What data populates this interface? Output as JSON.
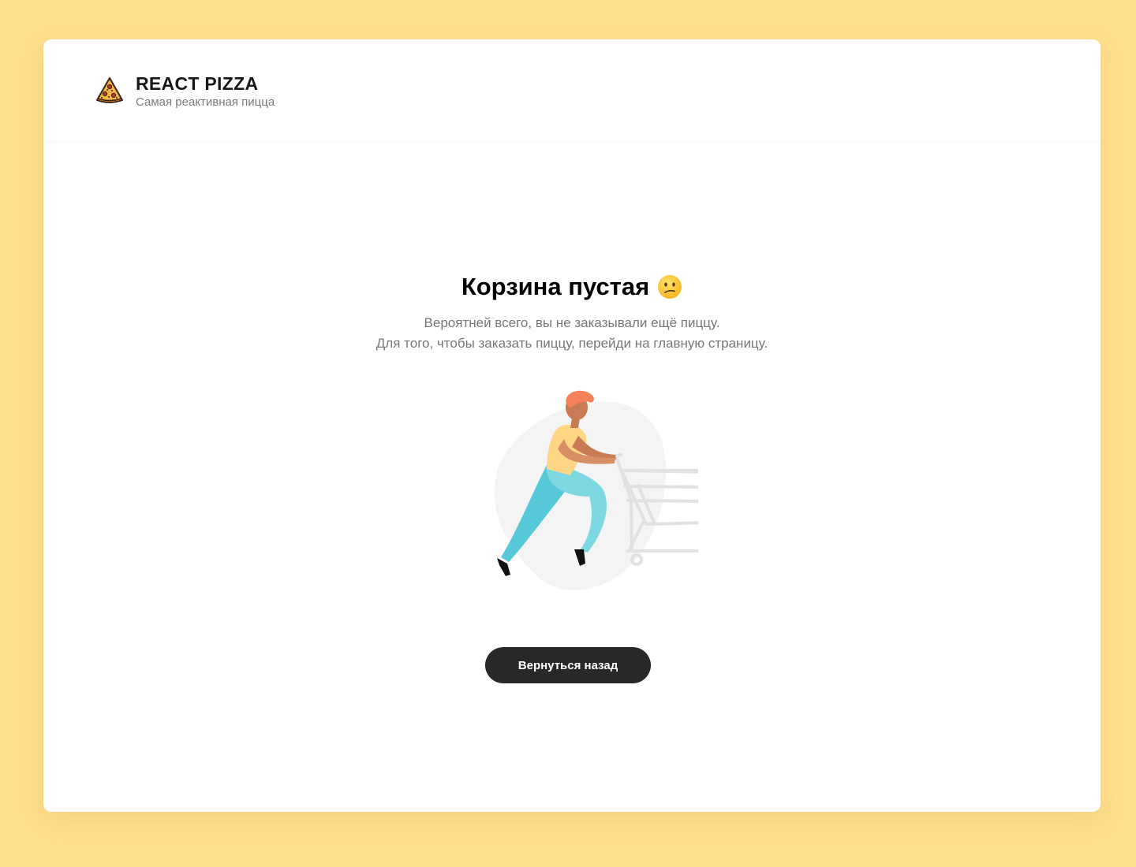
{
  "header": {
    "logo_icon": "pizza-slice-icon",
    "title": "REACT PIZZA",
    "subtitle": "Самая реактивная пицца"
  },
  "cart_empty": {
    "title": "Корзина пустая",
    "title_emoji_icon": "confused-face-emoji",
    "description_line1": "Вероятней всего, вы не заказывали ещё пиццу.",
    "description_line2": "Для того, чтобы заказать пиццу, перейди на главную страницу.",
    "illustration": "person-pushing-shopping-cart",
    "back_button_label": "Вернуться назад"
  },
  "colors": {
    "page_background": "#FFDF8C",
    "card_background": "#FFFFFF",
    "button_background": "#282828",
    "button_text": "#FFFFFF",
    "muted_text": "#777777"
  }
}
